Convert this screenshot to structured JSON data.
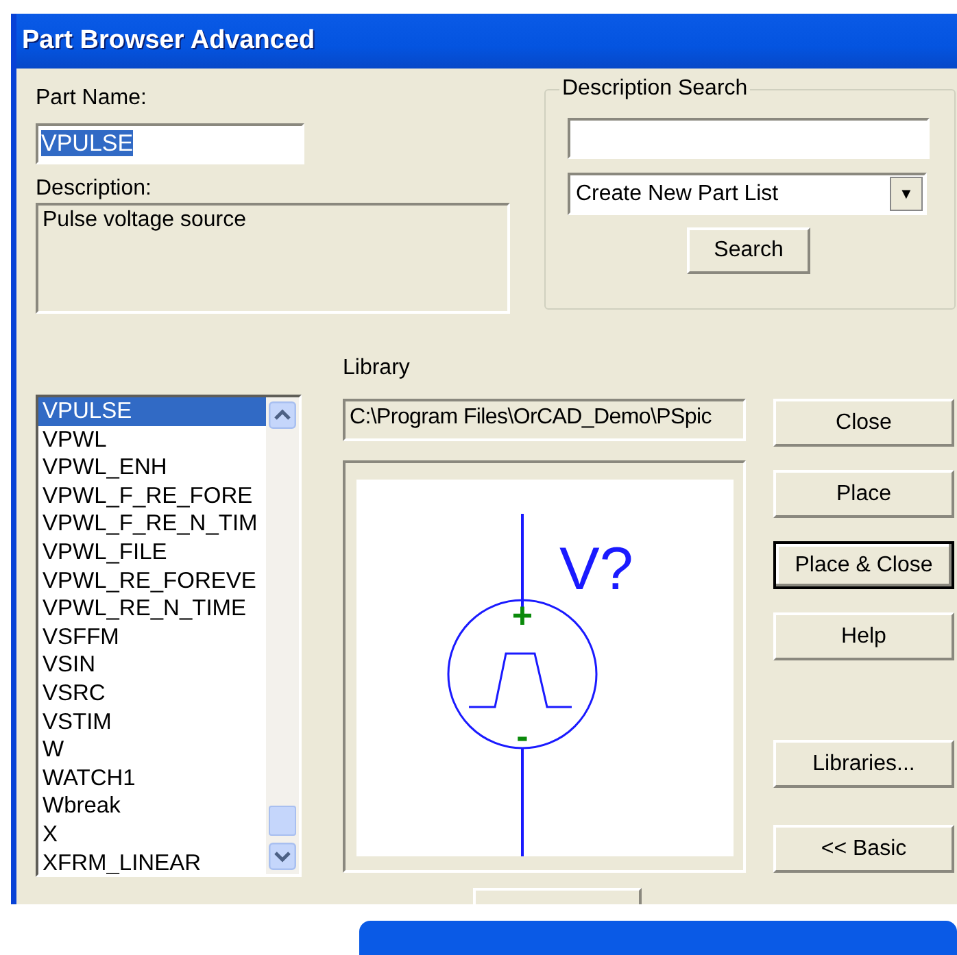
{
  "window": {
    "title": "Part Browser Advanced"
  },
  "part_name": {
    "label": "Part Name:",
    "value": "VPULSE",
    "value_selected": true
  },
  "description": {
    "label": "Description:",
    "value": "Pulse voltage source"
  },
  "description_search": {
    "title": "Description Search",
    "dropdown": "Create New Part List",
    "dropdown_arrow": "▼",
    "button": "Search"
  },
  "parts": [
    {
      "name": "VPULSE",
      "selected": true
    },
    {
      "name": "VPWL",
      "selected": false
    },
    {
      "name": "VPWL_ENH",
      "selected": false
    },
    {
      "name": "VPWL_F_RE_FORE",
      "selected": false
    },
    {
      "name": "VPWL_F_RE_N_TIM",
      "selected": false
    },
    {
      "name": "VPWL_FILE",
      "selected": false
    },
    {
      "name": "VPWL_RE_FOREVE",
      "selected": false
    },
    {
      "name": "VPWL_RE_N_TIME",
      "selected": false
    },
    {
      "name": "VSFFM",
      "selected": false
    },
    {
      "name": "VSIN",
      "selected": false
    },
    {
      "name": "VSRC",
      "selected": false
    },
    {
      "name": "VSTIM",
      "selected": false
    },
    {
      "name": "W",
      "selected": false
    },
    {
      "name": "WATCH1",
      "selected": false
    },
    {
      "name": "Wbreak",
      "selected": false
    },
    {
      "name": "X",
      "selected": false
    },
    {
      "name": "XFRM_LINEAR",
      "selected": false
    }
  ],
  "library": {
    "label": "Library",
    "path": "C:\\Program Files\\OrCAD_Demo\\PSpic"
  },
  "preview": {
    "reference": "V?",
    "plus": "+",
    "minus": "-"
  },
  "top_buttons": [
    {
      "label": "Close",
      "default": false
    },
    {
      "label": "Place",
      "default": false
    },
    {
      "label": "Place & Close",
      "default": true
    },
    {
      "label": "Help",
      "default": false
    }
  ],
  "bottom_buttons": [
    {
      "label": "Libraries...",
      "default": false
    },
    {
      "label": "<< Basic",
      "default": false
    }
  ]
}
